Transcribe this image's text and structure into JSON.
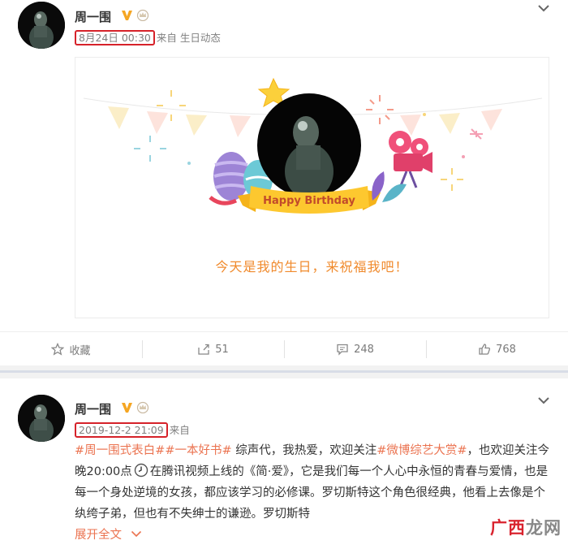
{
  "post1": {
    "username": "周一围",
    "timestamp": "8月24日 00:30",
    "source": "来自 生日动态",
    "card": {
      "banner_text": "Happy Birthday",
      "message": "今天是我的生日，来祝福我吧！"
    },
    "actions": {
      "favorite": "收藏",
      "repost": "51",
      "comment": "248",
      "like": "768"
    }
  },
  "post2": {
    "username": "周一围",
    "timestamp": "2019-12-2 21:09",
    "source": "来自",
    "text": {
      "tag1": "#周一围式表白#",
      "tag2": "#一本好书#",
      "seg1": " 综声代，我热爱，欢迎关注",
      "tag3": "#微博综艺大赏#",
      "seg2": "，也欢迎关注今晚20:00点",
      "seg3": "在腾讯视频上线的《简·爱》，它是我们每一个人心中永恒的青春与爱情，也是每一个身处逆境的女孩，都应该学习的必修课。罗切斯特这个角色很经典，他看上去像是个纨绔子弟，但也有不失绅士的谦逊。罗切斯特",
      "expand": "展开全文"
    }
  },
  "watermark": {
    "part1": "广西",
    "part2": "龙网"
  },
  "colors": {
    "tag": "#eb7350",
    "highlight_box": "#d6222a",
    "card_message": "#f08a2c",
    "verified": "#f5a623"
  }
}
